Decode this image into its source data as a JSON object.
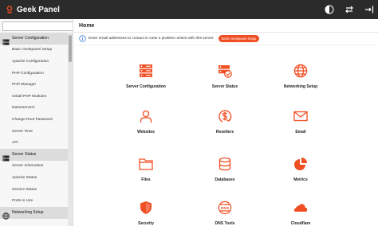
{
  "app": {
    "title": "Geek Panel"
  },
  "topbar": {
    "icons": [
      "theme-icon",
      "switch-icon",
      "logout-icon"
    ]
  },
  "sidebar": {
    "search": {
      "placeholder": ""
    },
    "entries": [
      {
        "type": "section",
        "label": "Server Configuration",
        "icon": "server-icon"
      },
      {
        "type": "item",
        "label": "Basic Geekpanel Setup"
      },
      {
        "type": "item",
        "label": "Apache Configuration"
      },
      {
        "type": "item",
        "label": "PHP Configuration"
      },
      {
        "type": "item",
        "label": "PHP Manager"
      },
      {
        "type": "item",
        "label": "Install PHP Modules"
      },
      {
        "type": "item",
        "label": "Nameservers"
      },
      {
        "type": "item",
        "label": "Change Root Password"
      },
      {
        "type": "item",
        "label": "Server Time"
      },
      {
        "type": "item",
        "label": "API"
      },
      {
        "type": "section",
        "label": "Server Status",
        "icon": "server-icon"
      },
      {
        "type": "item",
        "label": "Server Information"
      },
      {
        "type": "item",
        "label": "Apache Status"
      },
      {
        "type": "item",
        "label": "Service Status"
      },
      {
        "type": "item",
        "label": "Ports in Use"
      },
      {
        "type": "section",
        "label": "Networking Setup",
        "icon": "globe-icon"
      }
    ]
  },
  "main": {
    "title": "Home",
    "notice": {
      "text": "Enter email addresses to contact in case a problem arises with this server.",
      "button": "Basic Geekpanel Setup"
    },
    "tiles": [
      {
        "label": "Server Configuration",
        "icon": "server-config-icon"
      },
      {
        "label": "Server Status",
        "icon": "server-status-icon"
      },
      {
        "label": "Networking Setup",
        "icon": "globe-icon"
      },
      {
        "label": "Websites",
        "icon": "user-icon"
      },
      {
        "label": "Resellers",
        "icon": "dollar-icon"
      },
      {
        "label": "Email",
        "icon": "envelope-icon"
      },
      {
        "label": "Files",
        "icon": "folder-icon"
      },
      {
        "label": "Databases",
        "icon": "database-icon"
      },
      {
        "label": "Metrics",
        "icon": "pie-chart-icon"
      },
      {
        "label": "Security",
        "icon": "shield-icon"
      },
      {
        "label": "DNS Tools",
        "icon": "dns-icon"
      },
      {
        "label": "Cloudflare",
        "icon": "cloud-icon"
      }
    ]
  },
  "colors": {
    "accent": "#f04e23",
    "topbar": "#2b2b2b",
    "section": "#dcdcdc"
  }
}
